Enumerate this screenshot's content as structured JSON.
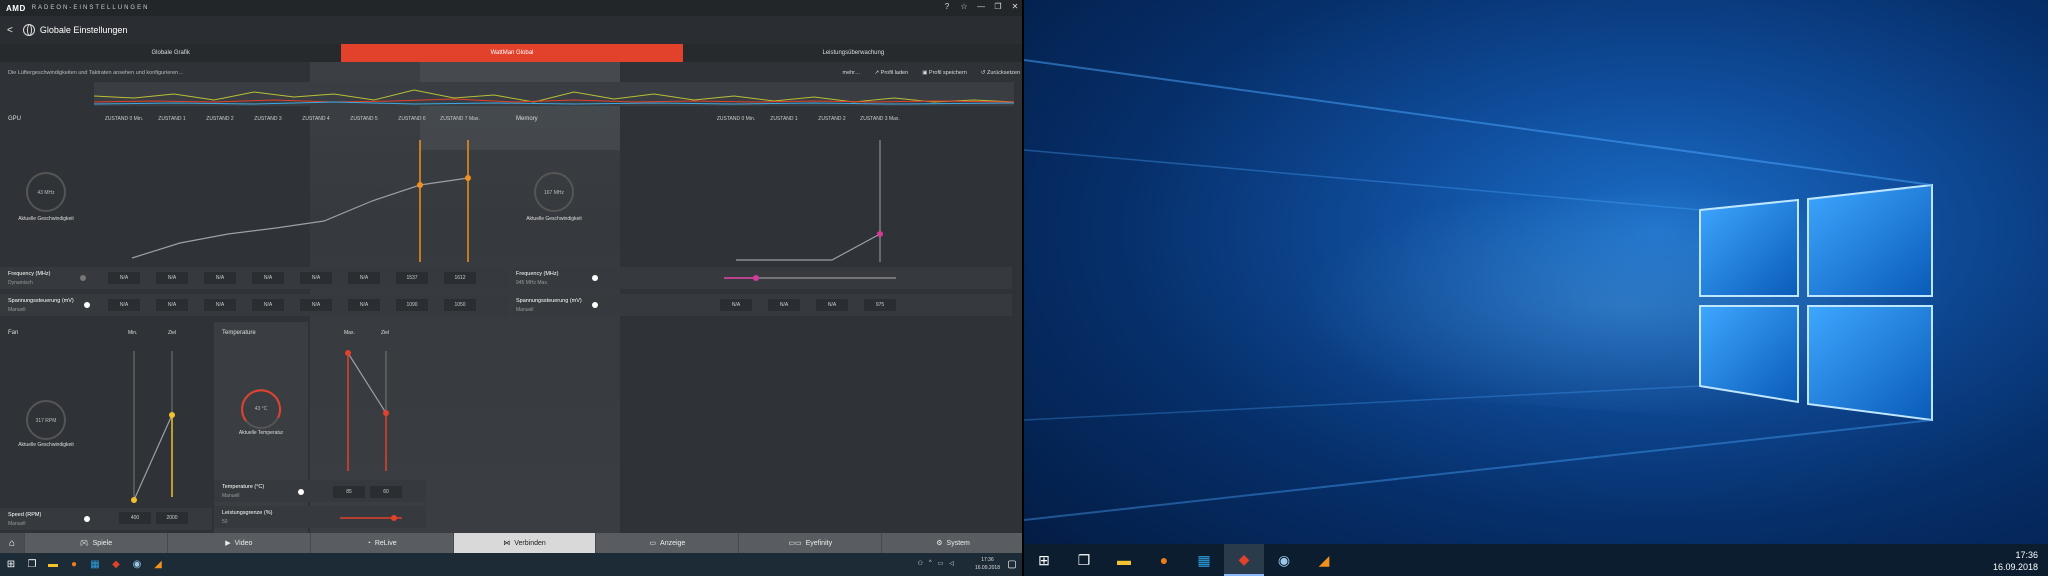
{
  "radeon": {
    "brand": "AMD",
    "app_name": "RADEON-EINSTELLUNGEN",
    "page_title": "Globale Einstellungen",
    "tabs": [
      {
        "label": "Globale Grafik"
      },
      {
        "label": "WattMan Global"
      },
      {
        "label": "Leistungsüberwachung"
      }
    ],
    "description": "Die Lüftergeschwindigkeiten und Taktraten ansehen und konfigurieren…",
    "actions": {
      "more": "mehr…",
      "load": "Profil laden",
      "save": "Profil speichern",
      "reset": "Zurücksetzen"
    },
    "gpu": {
      "label": "GPU",
      "states": [
        "ZUSTAND 0 Min.",
        "ZUSTAND 1",
        "ZUSTAND 2",
        "ZUSTAND 3",
        "ZUSTAND 4",
        "ZUSTAND 5",
        "ZUSTAND 6",
        "ZUSTAND 7 Max."
      ],
      "gauge_value": "43 MHz",
      "gauge_caption": "Aktuelle Geschwindigkeit",
      "freq_label": "Frequency (MHz)",
      "freq_sub": "Dynamisch",
      "freq_values": [
        "N/A",
        "N/A",
        "N/A",
        "N/A",
        "N/A",
        "N/A",
        "1537",
        "1612"
      ],
      "volt_label": "Spannungssteuerung (mV)",
      "volt_sub": "Manuell",
      "volt_values": [
        "N/A",
        "N/A",
        "N/A",
        "N/A",
        "N/A",
        "N/A",
        "1090",
        "1050"
      ]
    },
    "memory": {
      "label": "Memory",
      "states": [
        "ZUSTAND 0 Min.",
        "ZUSTAND 1",
        "ZUSTAND 2",
        "ZUSTAND 3 Max."
      ],
      "gauge_value": "167 MHz",
      "gauge_caption": "Aktuelle Geschwindigkeit",
      "freq_label": "Frequency (MHz)",
      "freq_sub": "945 MHz Max.",
      "volt_label": "Spannungssteuerung (mV)",
      "volt_sub": "Manuell",
      "volt_values": [
        "N/A",
        "N/A",
        "N/A",
        "975"
      ]
    },
    "fan": {
      "label": "Fan",
      "col_min": "Min.",
      "col_target": "Ziel",
      "gauge_value": "317 RPM",
      "gauge_caption": "Aktuelle Geschwindigkeit",
      "speed_label": "Speed (RPM)",
      "speed_sub": "Manuell",
      "speed_values": [
        "400",
        "2000"
      ]
    },
    "temperature": {
      "label": "Temperature",
      "col_max": "Max.",
      "col_target": "Ziel",
      "gauge_value": "43 °C",
      "gauge_caption": "Aktuelle Temperatur",
      "temp_label": "Temperature (°C)",
      "temp_sub": "Manuell",
      "temp_values": [
        "85",
        "60"
      ],
      "power_label": "Leistungsgrenze (%)",
      "power_sub": "50"
    },
    "bottom_nav": [
      {
        "label": "Spiele",
        "icon": "gamepad-icon"
      },
      {
        "label": "Video",
        "icon": "play-icon"
      },
      {
        "label": "ReLive",
        "icon": "relive-icon"
      },
      {
        "label": "Verbinden",
        "icon": "share-icon"
      },
      {
        "label": "Anzeige",
        "icon": "monitor-icon"
      },
      {
        "label": "Eyefinity",
        "icon": "eyefinity-icon"
      },
      {
        "label": "System",
        "icon": "gear-icon"
      }
    ],
    "accent_color": "#e2412b",
    "gpu_curve_color": "#f0901e",
    "memory_curve_color": "#d6399c",
    "fan_curve_color": "#f2c12e",
    "temp_curve_color": "#e2412b"
  },
  "taskbar_left": {
    "time": "17:36",
    "date": "16.09.2018"
  },
  "taskbar_right": {
    "time": "17:36",
    "date": "16.09.2018"
  }
}
